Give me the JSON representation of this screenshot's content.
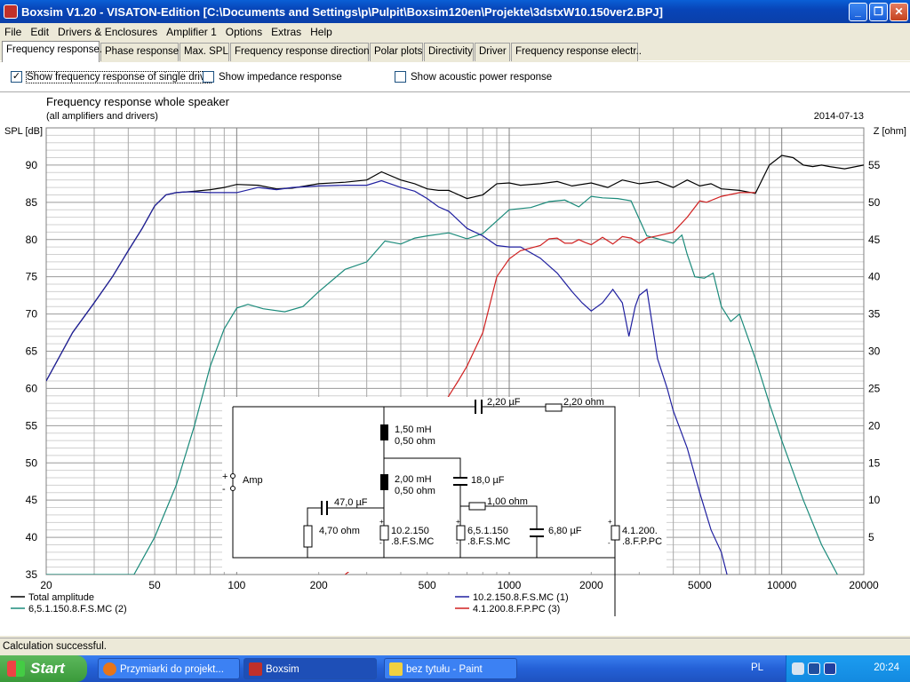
{
  "window": {
    "title": "Boxsim V1.20 - VISATON-Edition [C:\\Documents and Settings\\p\\Pulpit\\Boxsim120en\\Projekte\\3dstxW10.150ver2.BPJ]"
  },
  "menu": [
    "File",
    "Edit",
    "Drivers & Enclosures",
    "Amplifier 1",
    "Options",
    "Extras",
    "Help"
  ],
  "tabs": [
    "Frequency response.",
    "Phase response",
    "Max. SPL",
    "Frequency response directions",
    "Polar plots",
    "Directivity",
    "Driver",
    "Frequency response electr.."
  ],
  "options": {
    "single_driver": {
      "label": "Show frequency response of single drive",
      "checked": "✓"
    },
    "impedance": {
      "label": "Show impedance response"
    },
    "acoustic_power": {
      "label": "Show acoustic power response"
    }
  },
  "status": "Calculation successful.",
  "taskbar": {
    "start": "Start",
    "tasks": [
      "Przymiarki do projekt...",
      "Boxsim",
      "bez tytułu - Paint"
    ],
    "lang": "PL",
    "clock": "20:24"
  },
  "chart_data": {
    "type": "line",
    "title": "Frequency response whole speaker",
    "subtitle": "(all amplifiers and drivers)",
    "date": "2014-07-13",
    "ylabel": "SPL [dB]",
    "y2label": "Z [ohm]",
    "xscale": "log",
    "xlim": [
      20,
      20000
    ],
    "ylim": [
      35,
      95
    ],
    "y2lim": [
      0,
      60
    ],
    "xticks": [
      20,
      50,
      100,
      200,
      500,
      1000,
      2000,
      5000,
      10000,
      20000
    ],
    "yticks": [
      35,
      40,
      45,
      50,
      55,
      60,
      65,
      70,
      75,
      80,
      85,
      90
    ],
    "y2ticks": [
      5,
      10,
      15,
      20,
      25,
      30,
      35,
      40,
      45,
      50,
      55
    ],
    "grid": true,
    "legend": [
      {
        "name": "Total amplitude",
        "color": "#000000"
      },
      {
        "name": "6,5.1.150.8.F.S.MC (2)",
        "color": "#1a8a7a"
      },
      {
        "name": "10.2.150.8.F.S.MC (1)",
        "color": "#2020a0"
      },
      {
        "name": "4.1.200.8.F.P.PC (3)",
        "color": "#d02020"
      }
    ],
    "series": [
      {
        "name": "Total amplitude",
        "color": "#000000",
        "x": [
          20,
          25,
          30,
          35,
          40,
          45,
          50,
          55,
          60,
          65,
          70,
          80,
          90,
          100,
          120,
          140,
          160,
          200,
          250,
          300,
          340,
          400,
          450,
          500,
          550,
          600,
          700,
          800,
          900,
          1000,
          1100,
          1300,
          1500,
          1700,
          2000,
          2300,
          2600,
          3000,
          3500,
          4000,
          4500,
          5000,
          5500,
          6000,
          7000,
          8000,
          9000,
          10000,
          11000,
          12000,
          13000,
          14000,
          15000,
          17000,
          20000
        ],
        "y": [
          61,
          67.5,
          71.5,
          75,
          78.5,
          81.5,
          84.5,
          86,
          86.3,
          86.4,
          86.5,
          86.7,
          87,
          87.4,
          87.3,
          86.8,
          86.9,
          87.5,
          87.7,
          88,
          89.1,
          88,
          87.5,
          86.8,
          86.6,
          86.6,
          85.5,
          86,
          87.5,
          87.6,
          87.3,
          87.5,
          87.8,
          87.2,
          87.6,
          87,
          88,
          87.5,
          87.8,
          87,
          88,
          87.2,
          87.5,
          86.8,
          86.6,
          86.2,
          90,
          91.3,
          91,
          90,
          89.8,
          90,
          89.8,
          89.5,
          90
        ]
      },
      {
        "name": "6,5.1.150.8.F.S.MC (2)",
        "color": "#1a8a7a",
        "x": [
          20,
          42,
          50,
          60,
          70,
          80,
          90,
          100,
          110,
          125,
          150,
          175,
          200,
          250,
          300,
          350,
          400,
          450,
          500,
          600,
          700,
          800,
          900,
          1000,
          1200,
          1400,
          1600,
          1800,
          2000,
          2200,
          2500,
          2800,
          3200,
          3600,
          4000,
          4300,
          4500,
          4800,
          5200,
          5600,
          6000,
          6500,
          7000,
          8000,
          9000,
          10000,
          12000,
          14000,
          16000
        ],
        "y": [
          35,
          35,
          40,
          47,
          55,
          63,
          68,
          70.8,
          71.3,
          70.7,
          70.3,
          71,
          73,
          76,
          77,
          79.8,
          79.4,
          80.2,
          80.5,
          80.9,
          80.1,
          80.8,
          82.5,
          84,
          84.3,
          85.1,
          85.3,
          84.4,
          85.8,
          85.6,
          85.5,
          85.2,
          80.5,
          80,
          79.5,
          80.6,
          78,
          75,
          74.8,
          75.5,
          71,
          69,
          70,
          64,
          58,
          53,
          45,
          39,
          35
        ]
      },
      {
        "name": "10.2.150.8.F.S.MC (1)",
        "color": "#2020a0",
        "x": [
          20,
          25,
          30,
          35,
          40,
          45,
          50,
          55,
          60,
          65,
          70,
          80,
          90,
          100,
          120,
          140,
          160,
          200,
          250,
          300,
          340,
          400,
          450,
          500,
          550,
          600,
          700,
          800,
          900,
          1000,
          1100,
          1300,
          1500,
          1700,
          1850,
          2000,
          2200,
          2400,
          2600,
          2750,
          2900,
          3000,
          3200,
          3500,
          3800,
          4000,
          4500,
          5000,
          5500,
          6000,
          6300
        ],
        "y": [
          61,
          67.5,
          71.5,
          75,
          78.5,
          81.5,
          84.5,
          86,
          86.3,
          86.4,
          86.4,
          86.3,
          86.3,
          86.3,
          87,
          86.7,
          87,
          87.2,
          87.3,
          87.3,
          87.9,
          87,
          86.5,
          85.5,
          84.4,
          83.8,
          81.5,
          80.5,
          79.2,
          79,
          79,
          77.5,
          75.5,
          73,
          71.5,
          70.4,
          71.5,
          73.3,
          71.5,
          67,
          71,
          72.5,
          73.3,
          64,
          60,
          57,
          52,
          46,
          41,
          38,
          35
        ]
      },
      {
        "name": "4.1.200.8.F.P.PC (3)",
        "color": "#d02020",
        "x": [
          250,
          260,
          270,
          600,
          650,
          700,
          800,
          900,
          1000,
          1100,
          1300,
          1400,
          1500,
          1600,
          1700,
          1800,
          1900,
          2000,
          2200,
          2400,
          2600,
          2800,
          3000,
          3200,
          3500,
          4000,
          4500,
          5000,
          5300,
          6000,
          7000,
          8000
        ],
        "y": [
          35,
          35.5,
          36,
          59,
          61,
          63,
          67.5,
          75,
          77.4,
          78.5,
          79.2,
          80.1,
          80.2,
          79.5,
          79.5,
          80,
          79.6,
          79.3,
          80.3,
          79.4,
          80.4,
          80.2,
          79.5,
          80.2,
          80.5,
          81,
          83,
          85.2,
          85,
          85.8,
          86.3,
          86.3
        ]
      }
    ]
  },
  "schematic": {
    "c_tweeter": "2,20 µF",
    "r_tweeter": "2,20 ohm",
    "l1_value": "1,50 mH",
    "l1_res": "0,50 ohm",
    "l2_value": "2,00 mH",
    "l2_res": "0,50 ohm",
    "c_mid": "18,0 µF",
    "r_mid": "1,00 ohm",
    "c_mid2": "6,80 µF",
    "c_woofer": "47,0 µF",
    "r_woofer": "4,70 ohm",
    "amp": "Amp",
    "plus": "+",
    "minus": "-",
    "d1": [
      "10.2.150",
      ".8.F.S.MC"
    ],
    "d2": [
      "6,5.1.150",
      ".8.F.S.MC"
    ],
    "d3": [
      "4.1.200.",
      ".8.F.P.PC"
    ]
  }
}
